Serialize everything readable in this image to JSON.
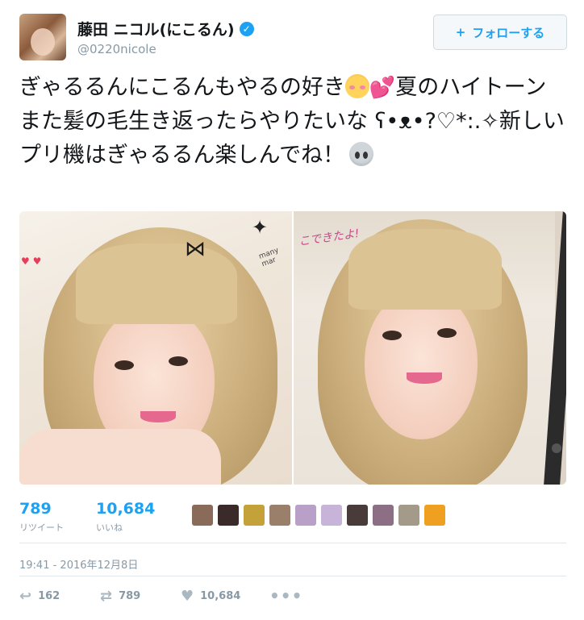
{
  "author": {
    "display_name": "藤田 ニコル(にこるん)",
    "handle": "@0220nicole",
    "verified_glyph": "✓"
  },
  "follow_button": {
    "icon": "add-user-icon",
    "icon_glyph": "⁺👤",
    "label": "フォローする"
  },
  "tweet": {
    "text_part1": "ぎゃるるんにこるんもやるの好き",
    "text_part2": "夏のハイトーンまた髪の毛生き返ったらやりたいな ʕ•ᴥ•?♡*:.✧新しいプリ機はぎゃるるん楽しんでね！",
    "emoji_1": "flushed-face-emoji",
    "emoji_2": "two-hearts-emoji",
    "emoji_2_glyph": "💕",
    "emoji_3": "alien-emoji"
  },
  "media": {
    "left_caption_text": "many mar",
    "right_caption_text": "こできたよ!",
    "left_sticker": "✦",
    "left_hearts": "♥ ♥",
    "bow_glyph": "⋈"
  },
  "stats": {
    "retweets": {
      "count": "789",
      "label": "リツイート"
    },
    "likes": {
      "count": "10,684",
      "label": "いいね"
    }
  },
  "likers": [
    "#8a6b5a",
    "#3a2a2a",
    "#c5a13a",
    "#9a7f6a",
    "#b8a0c8",
    "#c9b4d9",
    "#4a3b3b",
    "#8c6f85",
    "#a39a8a",
    "#f0a020"
  ],
  "timestamp": "19:41 - 2016年12月8日",
  "actions": {
    "reply_icon": "reply-icon",
    "reply_glyph": "↩",
    "reply_count": "162",
    "retweet_icon": "retweet-icon",
    "retweet_glyph": "⇄",
    "retweet_count": "789",
    "like_icon": "heart-icon",
    "like_glyph": "♥",
    "like_count": "10,684",
    "more_icon": "more-icon",
    "more_glyph": "•••"
  },
  "colors": {
    "accent": "#1da1f2",
    "muted": "#8899a6",
    "text": "#14171a"
  }
}
